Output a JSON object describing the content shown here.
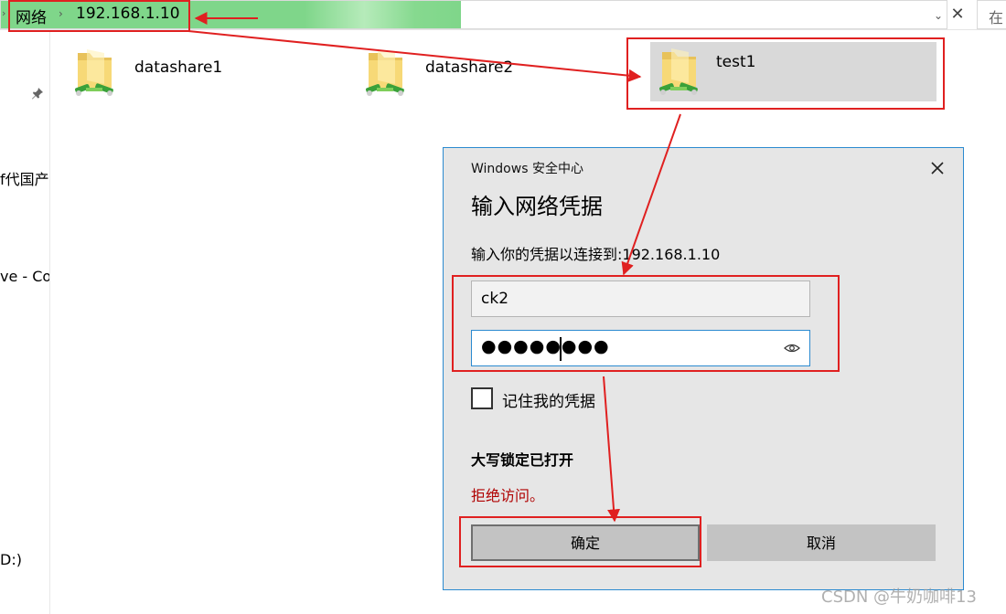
{
  "address_bar": {
    "crumbs": [
      "网络",
      "192.168.1.10"
    ],
    "search_placeholder": "在"
  },
  "nav_pane": {
    "items": [
      "f代国产",
      "ve - Co",
      "D:)"
    ]
  },
  "folders": [
    {
      "name": "datashare1",
      "selected": false
    },
    {
      "name": "datashare2",
      "selected": false
    },
    {
      "name": "test1",
      "selected": true
    }
  ],
  "dialog": {
    "window_title": "Windows 安全中心",
    "heading": "输入网络凭据",
    "subtitle": "输入你的凭据以连接到:192.168.1.10",
    "username_value": "ck2",
    "password_mask": "●●●●●●●●",
    "remember_label": "记住我的凭据",
    "remember_checked": false,
    "caps_lock_message": "大写锁定已打开",
    "error_message": "拒绝访问。",
    "ok_label": "确定",
    "cancel_label": "取消"
  },
  "colors": {
    "annotation_red": "#e02020",
    "progress_green": "#7fd68a",
    "dialog_border": "#2b8ad0",
    "error_text": "#b00000"
  },
  "watermark": "CSDN @牛奶咖啡13"
}
